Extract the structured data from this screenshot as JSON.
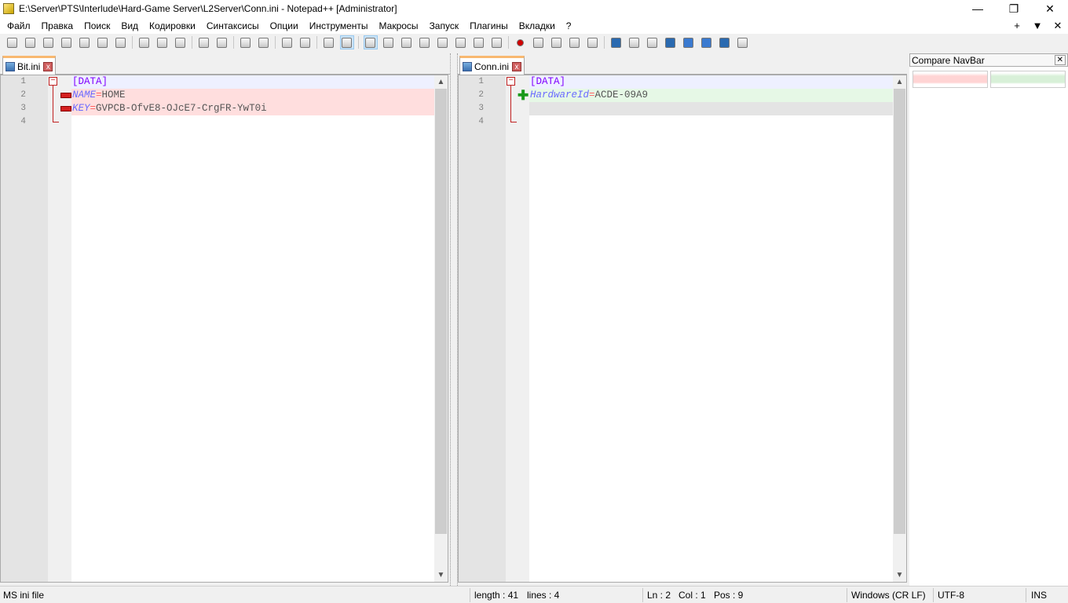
{
  "window": {
    "title": "E:\\Server\\PTS\\Interlude\\Hard-Game Server\\L2Server\\Conn.ini - Notepad++ [Administrator]",
    "minimize": "—",
    "restore": "❐",
    "close": "✕"
  },
  "menu": {
    "items": [
      "Файл",
      "Правка",
      "Поиск",
      "Вид",
      "Кодировки",
      "Синтаксисы",
      "Опции",
      "Инструменты",
      "Макросы",
      "Запуск",
      "Плагины",
      "Вкладки",
      "?"
    ],
    "right": [
      "+",
      "▼",
      "✕"
    ]
  },
  "toolbar": {
    "groups": [
      [
        "new-file",
        "open-file",
        "save",
        "save-all",
        "close",
        "close-all",
        "print"
      ],
      [
        "cut",
        "copy",
        "paste"
      ],
      [
        "undo",
        "redo"
      ],
      [
        "find",
        "replace"
      ],
      [
        "zoom-in",
        "zoom-out"
      ],
      [
        "sync-vertical",
        "sync-horizontal"
      ],
      [
        "word-wrap",
        "show-all-chars",
        "indent-guide",
        "udl",
        "doc-map",
        "function-list",
        "folder-workspace",
        "monitor"
      ],
      [
        "record-macro",
        "stop-record",
        "play-macro",
        "run-macro-multiple",
        "save-macro"
      ],
      [
        "compare",
        "compare-lines",
        "clear-compare",
        "first-diff",
        "prev-diff",
        "next-diff",
        "last-diff",
        "compare-navbar"
      ]
    ],
    "active": [
      "sync-horizontal",
      "word-wrap"
    ],
    "colors": {
      "record-macro": "#d00000",
      "compare": "#2a6ab0",
      "first-diff": "#2a6ab0",
      "prev-diff": "#3a7ad0",
      "next-diff": "#3a7ad0",
      "last-diff": "#2a6ab0"
    }
  },
  "left": {
    "tab": "Bit.ini",
    "lines": [
      {
        "n": "1",
        "section": "[DATA]",
        "status": "normal"
      },
      {
        "n": "2",
        "key": "NAME",
        "eq": "=",
        "value": "HOME",
        "status": "removed"
      },
      {
        "n": "3",
        "key": "KEY",
        "eq": "=",
        "value": "GVPCB-OfvE8-OJcE7-CrgFR-YwT0i",
        "status": "removed"
      },
      {
        "n": "4",
        "status": "normal"
      }
    ]
  },
  "right": {
    "tab": "Conn.ini",
    "lines": [
      {
        "n": "1",
        "section": "[DATA]",
        "status": "normal"
      },
      {
        "n": "2",
        "key": "HardwareId",
        "eq": "=",
        "value": "ACDE-09A9",
        "status": "added"
      },
      {
        "n": "3",
        "status": "blank"
      },
      {
        "n": "4",
        "status": "normal"
      }
    ]
  },
  "navbar": {
    "title": "Compare NavBar",
    "close": "✕"
  },
  "colors": {
    "removed": "#ffdede",
    "added": "#e6f8e6",
    "blank": "#e4e4e4",
    "current": "#eef0ff"
  },
  "status": {
    "type": "MS ini file",
    "length": "length : 41",
    "lines": "lines : 4",
    "ln": "Ln : 2",
    "col": "Col : 1",
    "pos": "Pos : 9",
    "eol": "Windows (CR LF)",
    "encoding": "UTF-8",
    "mode": "INS"
  }
}
